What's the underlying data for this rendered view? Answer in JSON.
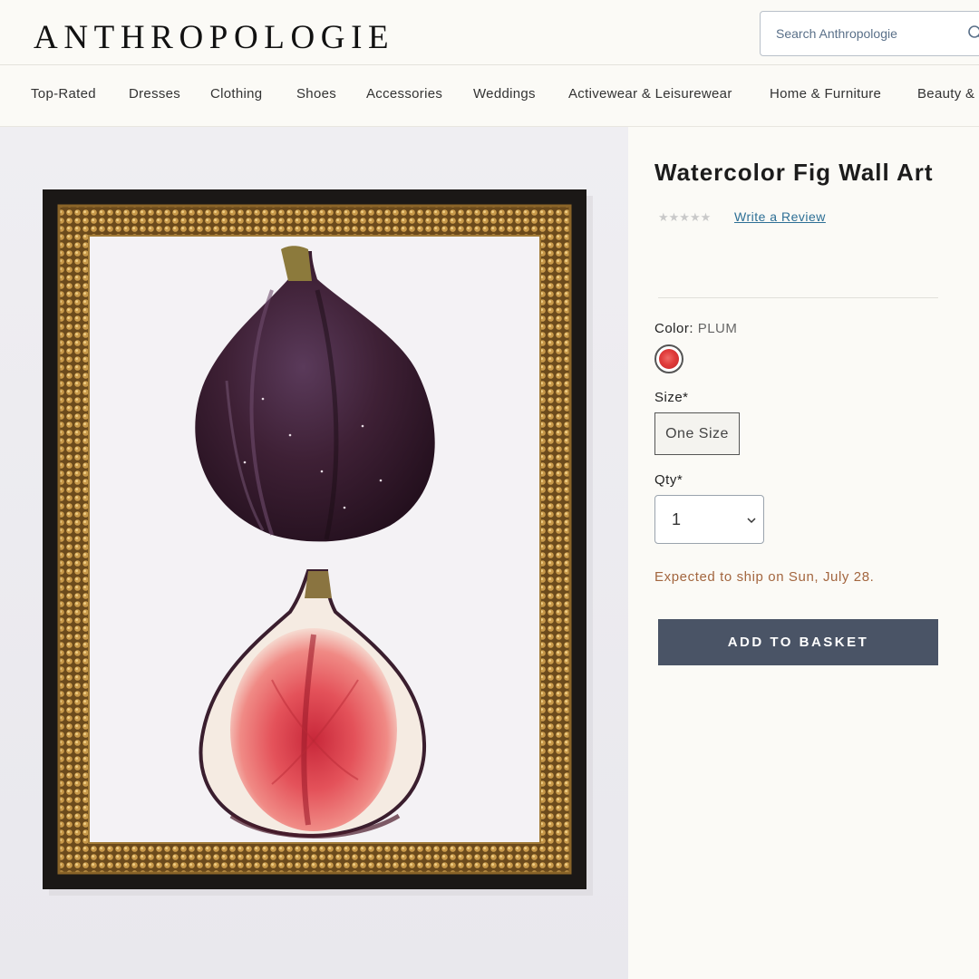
{
  "header": {
    "logo": "ANTHROPOLOGIE",
    "search_placeholder": "Search Anthropologie"
  },
  "nav": {
    "items": [
      {
        "label": "Top-Rated"
      },
      {
        "label": "Dresses"
      },
      {
        "label": "Clothing"
      },
      {
        "label": "Shoes"
      },
      {
        "label": "Accessories"
      },
      {
        "label": "Weddings"
      },
      {
        "label": "Activewear & Leisurewear"
      },
      {
        "label": "Home & Furniture"
      },
      {
        "label": "Beauty &"
      }
    ]
  },
  "product": {
    "title": "Watercolor Fig Wall Art",
    "stars": "★★★★★",
    "review_link": "Write a Review",
    "color_label": "Color:",
    "color_value": "PLUM",
    "size_label": "Size*",
    "size_option": "One Size",
    "qty_label": "Qty*",
    "qty_value": "1",
    "ship_note": "Expected to ship on Sun, July 28.",
    "add_button": "ADD TO BASKET"
  },
  "colors": {
    "button": "#4a5466",
    "ship_note": "#a3663f",
    "link": "#2d6f95",
    "swatch": "#e03b3a"
  }
}
